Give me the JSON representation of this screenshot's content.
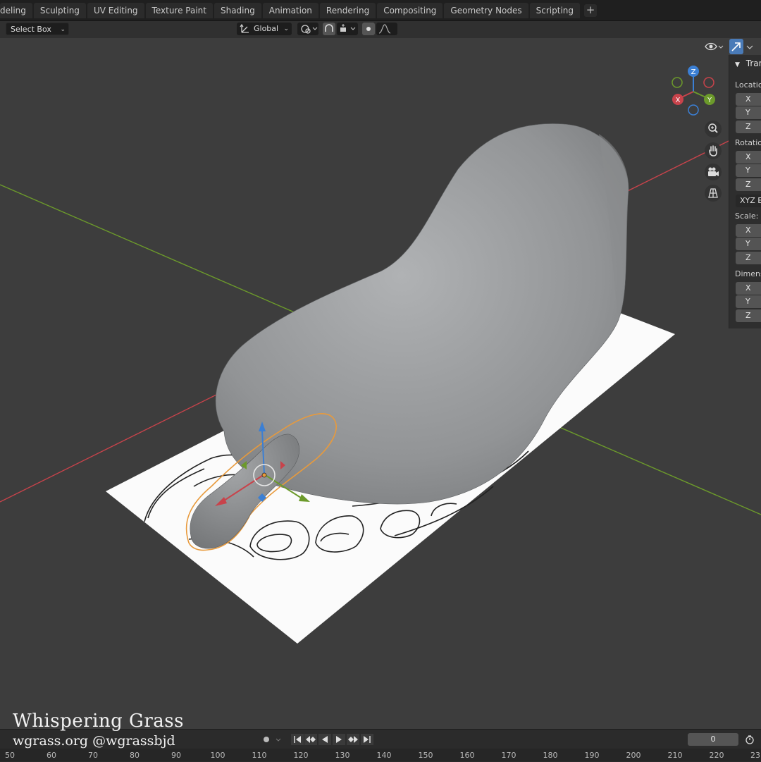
{
  "workspace_tabs": [
    "deling",
    "Sculpting",
    "UV Editing",
    "Texture Paint",
    "Shading",
    "Animation",
    "Rendering",
    "Compositing",
    "Geometry Nodes",
    "Scripting"
  ],
  "add_tab_label": "+",
  "header": {
    "select_mode": "Select Box",
    "orientation": "Global"
  },
  "gizmo": {
    "x": "X",
    "y": "Y",
    "z": "Z"
  },
  "npanel": {
    "title": "Tran",
    "location_label": "Locatio",
    "rotation_label": "Rotatio",
    "rotation_mode": "XYZ E",
    "scale_label": "Scale:",
    "dimensions_label": "Dimens",
    "axes": [
      "X",
      "Y",
      "Z"
    ]
  },
  "watermark": {
    "name": "Whispering Grass",
    "handle": "wgrass.org @wgrassbjd"
  },
  "timeline": {
    "current_frame": "0",
    "ruler_ticks": [
      "50",
      "60",
      "70",
      "80",
      "90",
      "100",
      "110",
      "120",
      "130",
      "140",
      "150",
      "160",
      "170",
      "180",
      "190",
      "200",
      "210",
      "220",
      "23"
    ]
  },
  "colors": {
    "x_axis": "#c8434b",
    "y_axis": "#6c9a2b",
    "z_axis": "#3b7fd4",
    "selection_outline": "#e89a3c",
    "active_tool": "#4a7bb8"
  },
  "icons": [
    "transform-orientation-icon",
    "pivot-icon",
    "snap-icon",
    "proportional-edit-icon",
    "visibility-icon",
    "gizmo-icon",
    "zoom-icon",
    "hand-pan-icon",
    "camera-icon",
    "grid-perspective-icon",
    "record-icon",
    "jump-start-icon",
    "keyframe-prev-icon",
    "play-reverse-icon",
    "play-icon",
    "keyframe-next-icon",
    "jump-end-icon",
    "stopwatch-icon"
  ]
}
